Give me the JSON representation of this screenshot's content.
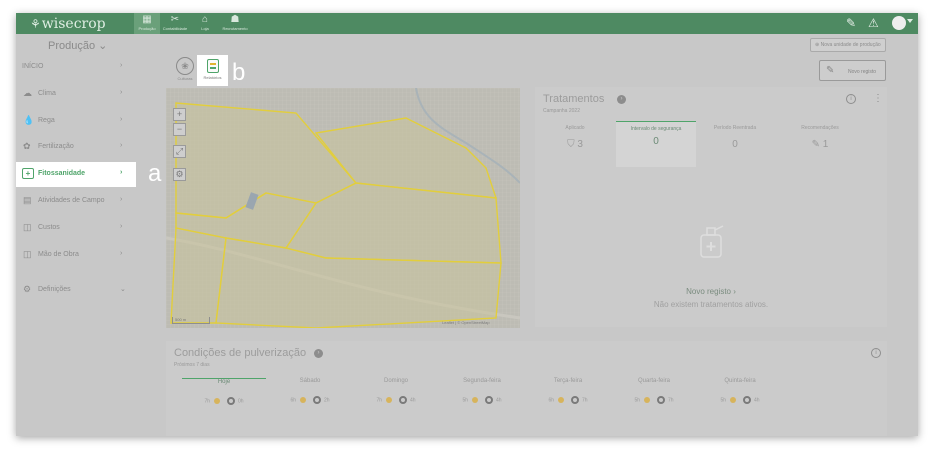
{
  "colors": {
    "brand_green": "#4e8a62",
    "accent_green": "#4fa46a",
    "field_outline": "#e2ce3c"
  },
  "topbar": {
    "logo": "wisecrop",
    "nav": [
      {
        "label": "Produção",
        "icon": "grid-icon",
        "active": true
      },
      {
        "label": "Contabilidade",
        "icon": "scissors-icon",
        "active": false
      },
      {
        "label": "Loja",
        "icon": "basket-icon",
        "active": false
      },
      {
        "label": "Recrutamento",
        "icon": "people-icon",
        "active": false
      }
    ],
    "right_icons": [
      "edit-icon",
      "alert-icon",
      "user-avatar"
    ]
  },
  "production": {
    "selector_label": "Produção ⌄",
    "add_button": "Nova unidade de produção"
  },
  "sidebar": {
    "items": [
      {
        "label": "INÍCIO",
        "icon": ""
      },
      {
        "label": "Clima",
        "icon": "cloud-icon"
      },
      {
        "label": "Rega",
        "icon": "drop-icon"
      },
      {
        "label": "Fertilização",
        "icon": "fertilizer-icon"
      },
      {
        "label": "Fitossanidade",
        "icon": "first-aid-icon",
        "active": true
      },
      {
        "label": "Atividades de Campo",
        "icon": "clipboard-icon"
      },
      {
        "label": "Custos",
        "icon": "cost-icon"
      },
      {
        "label": "Mão de Obra",
        "icon": "worker-icon"
      },
      {
        "label": "Definições",
        "icon": "settings-icon"
      }
    ],
    "arrow": "›"
  },
  "annotations": {
    "a": "a",
    "b": "b"
  },
  "toolbar": {
    "culturas_label": "Culturas",
    "relatorios_label": "Relatórios",
    "novo_registo": "Novo registo"
  },
  "map": {
    "controls": [
      "+",
      "−",
      "⤢",
      "⚙"
    ],
    "scale": "500 m",
    "attribution": "Leaflet | © OpenStreetMap"
  },
  "tratamentos": {
    "title": "Tratamentos",
    "subtitle": "Campanha 2022",
    "tabs": [
      {
        "label": "Aplicado",
        "value": "3"
      },
      {
        "label": "Intervalo de segurança",
        "value": "0"
      },
      {
        "label": "Período Reentrada",
        "value": "0"
      },
      {
        "label": "Recomendações",
        "value": "1"
      }
    ],
    "novo_registo": "Novo registo ›",
    "empty": "Não existem tratamentos ativos."
  },
  "pulverizacao": {
    "title": "Condições de pulverização",
    "subtitle": "Próximos 7 dias",
    "days": [
      {
        "name": "Hoje",
        "day_hours": "7h",
        "night_hours": "0h"
      },
      {
        "name": "Sábado",
        "day_hours": "6h",
        "night_hours": "2h"
      },
      {
        "name": "Domingo",
        "day_hours": "7h",
        "night_hours": "4h"
      },
      {
        "name": "Segunda-feira",
        "day_hours": "5h",
        "night_hours": "4h"
      },
      {
        "name": "Terça-feira",
        "day_hours": "6h",
        "night_hours": "7h"
      },
      {
        "name": "Quarta-feira",
        "day_hours": "5h",
        "night_hours": "7h"
      },
      {
        "name": "Quinta-feira",
        "day_hours": "5h",
        "night_hours": "4h"
      }
    ]
  }
}
